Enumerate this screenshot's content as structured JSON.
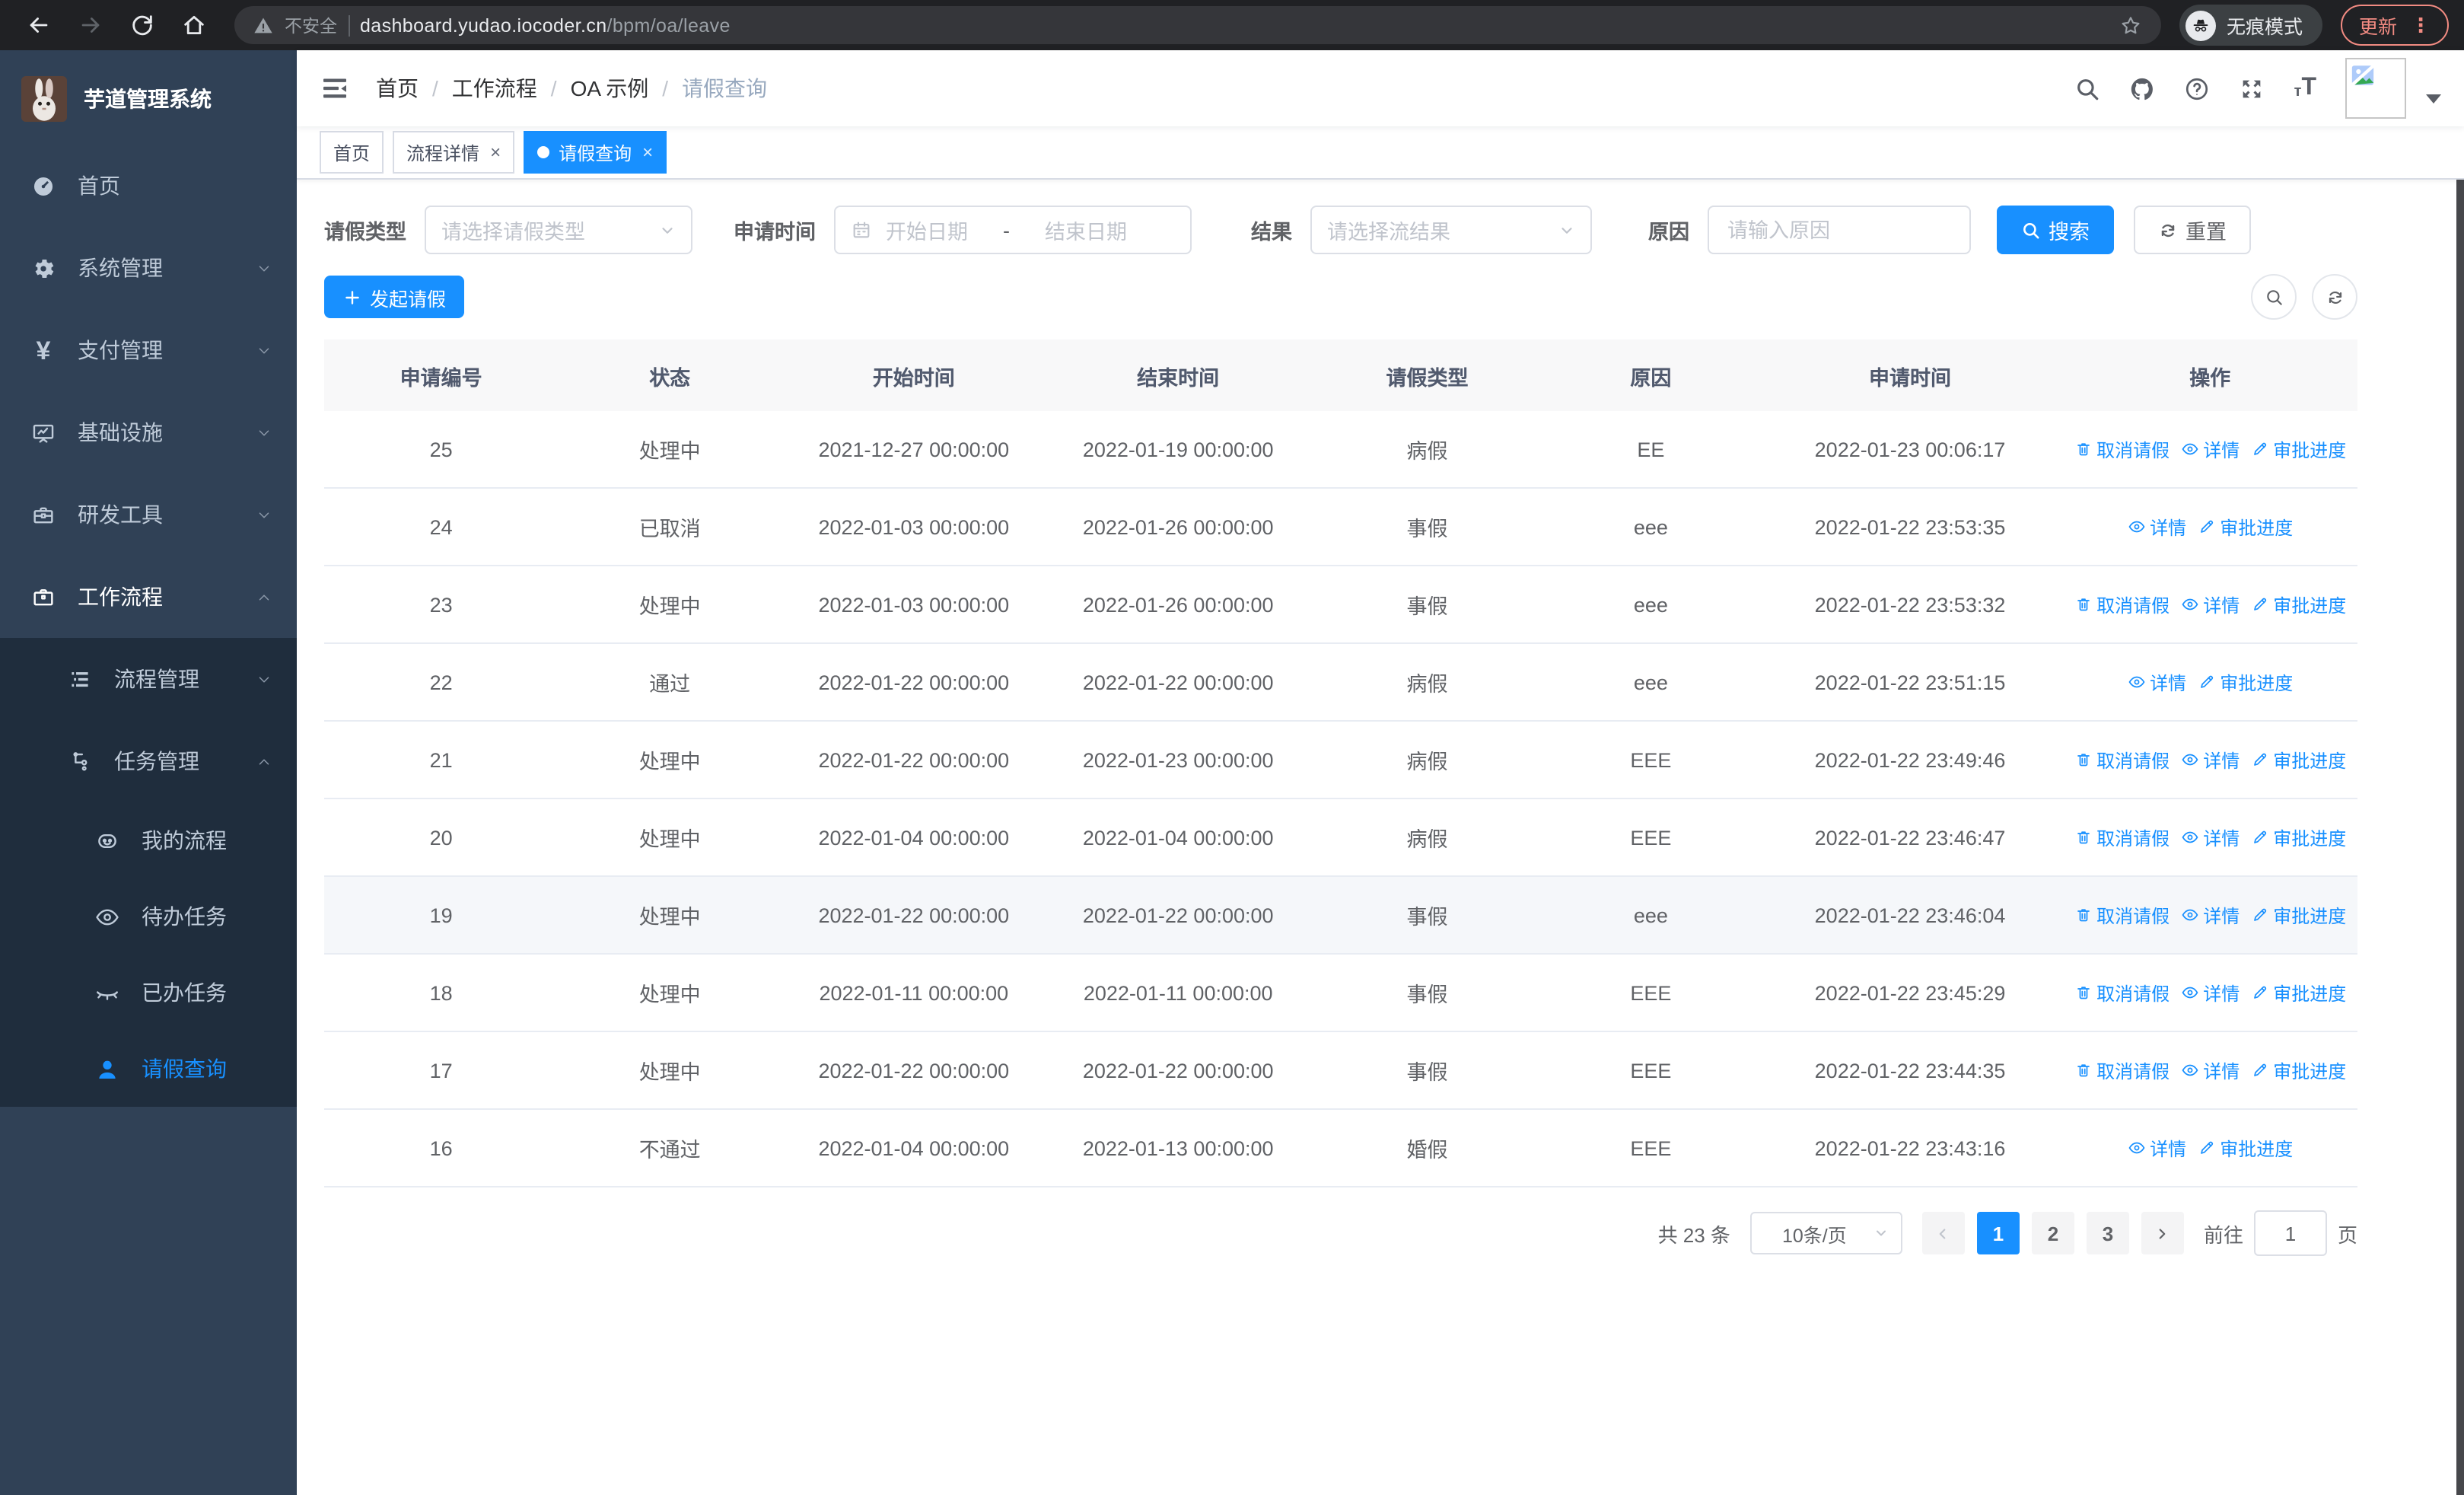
{
  "browser": {
    "security_label": "不安全",
    "url_host": "dashboard.yudao.iocoder.cn",
    "url_path": "/bpm/oa/leave",
    "incognito_label": "无痕模式",
    "update_label": "更新"
  },
  "colors": {
    "accent": "#1890ff",
    "sidebar_bg": "#304156",
    "submenu_bg": "#1f2d3d"
  },
  "sidebar": {
    "logo_title": "芋道管理系统",
    "items": [
      {
        "label": "首页",
        "icon": "dashboard"
      },
      {
        "label": "系统管理",
        "icon": "gear",
        "chevron": "down"
      },
      {
        "label": "支付管理",
        "icon": "yen",
        "chevron": "down"
      },
      {
        "label": "基础设施",
        "icon": "monitor",
        "chevron": "down"
      },
      {
        "label": "研发工具",
        "icon": "toolbox",
        "chevron": "down"
      },
      {
        "label": "工作流程",
        "icon": "briefcase",
        "chevron": "up",
        "parent_active": true
      }
    ],
    "submenu": [
      {
        "label": "流程管理",
        "icon": "flow-list",
        "chevron": "down",
        "level": 1
      },
      {
        "label": "任务管理",
        "icon": "tree",
        "chevron": "up",
        "level": 1
      },
      {
        "label": "我的流程",
        "icon": "robot",
        "level": 2
      },
      {
        "label": "待办任务",
        "icon": "eye-open",
        "level": 2
      },
      {
        "label": "已办任务",
        "icon": "eye-closed",
        "level": 2
      },
      {
        "label": "请假查询",
        "icon": "user",
        "level": 2,
        "active": true
      }
    ]
  },
  "navbar": {
    "breadcrumb": [
      "首页",
      "工作流程",
      "OA 示例",
      "请假查询"
    ]
  },
  "tags": [
    {
      "label": "首页",
      "closable": false,
      "active": false
    },
    {
      "label": "流程详情",
      "closable": true,
      "active": false
    },
    {
      "label": "请假查询",
      "closable": true,
      "active": true
    }
  ],
  "filters": {
    "leave_type_label": "请假类型",
    "leave_type_placeholder": "请选择请假类型",
    "apply_time_label": "申请时间",
    "start_placeholder": "开始日期",
    "range_separator": "-",
    "end_placeholder": "结束日期",
    "result_label": "结果",
    "result_placeholder": "请选择流结果",
    "reason_label": "原因",
    "reason_placeholder": "请输入原因",
    "search_label": "搜索",
    "reset_label": "重置"
  },
  "toolbar": {
    "create_label": "发起请假"
  },
  "table": {
    "headers": [
      "申请编号",
      "状态",
      "开始时间",
      "结束时间",
      "请假类型",
      "原因",
      "申请时间",
      "操作"
    ],
    "action_labels": {
      "cancel": "取消请假",
      "detail": "详情",
      "progress": "审批进度"
    },
    "rows": [
      {
        "id": "25",
        "status": "处理中",
        "start": "2021-12-27 00:00:00",
        "end": "2022-01-19 00:00:00",
        "type": "病假",
        "reason": "EE",
        "apply": "2022-01-23 00:06:17",
        "actions": [
          "cancel",
          "detail",
          "progress"
        ],
        "highlight": false
      },
      {
        "id": "24",
        "status": "已取消",
        "start": "2022-01-03 00:00:00",
        "end": "2022-01-26 00:00:00",
        "type": "事假",
        "reason": "eee",
        "apply": "2022-01-22 23:53:35",
        "actions": [
          "detail",
          "progress"
        ],
        "highlight": false
      },
      {
        "id": "23",
        "status": "处理中",
        "start": "2022-01-03 00:00:00",
        "end": "2022-01-26 00:00:00",
        "type": "事假",
        "reason": "eee",
        "apply": "2022-01-22 23:53:32",
        "actions": [
          "cancel",
          "detail",
          "progress"
        ],
        "highlight": false
      },
      {
        "id": "22",
        "status": "通过",
        "start": "2022-01-22 00:00:00",
        "end": "2022-01-22 00:00:00",
        "type": "病假",
        "reason": "eee",
        "apply": "2022-01-22 23:51:15",
        "actions": [
          "detail",
          "progress"
        ],
        "highlight": false
      },
      {
        "id": "21",
        "status": "处理中",
        "start": "2022-01-22 00:00:00",
        "end": "2022-01-23 00:00:00",
        "type": "病假",
        "reason": "EEE",
        "apply": "2022-01-22 23:49:46",
        "actions": [
          "cancel",
          "detail",
          "progress"
        ],
        "highlight": false
      },
      {
        "id": "20",
        "status": "处理中",
        "start": "2022-01-04 00:00:00",
        "end": "2022-01-04 00:00:00",
        "type": "病假",
        "reason": "EEE",
        "apply": "2022-01-22 23:46:47",
        "actions": [
          "cancel",
          "detail",
          "progress"
        ],
        "highlight": false
      },
      {
        "id": "19",
        "status": "处理中",
        "start": "2022-01-22 00:00:00",
        "end": "2022-01-22 00:00:00",
        "type": "事假",
        "reason": "eee",
        "apply": "2022-01-22 23:46:04",
        "actions": [
          "cancel",
          "detail",
          "progress"
        ],
        "highlight": true
      },
      {
        "id": "18",
        "status": "处理中",
        "start": "2022-01-11 00:00:00",
        "end": "2022-01-11 00:00:00",
        "type": "事假",
        "reason": "EEE",
        "apply": "2022-01-22 23:45:29",
        "actions": [
          "cancel",
          "detail",
          "progress"
        ],
        "highlight": false
      },
      {
        "id": "17",
        "status": "处理中",
        "start": "2022-01-22 00:00:00",
        "end": "2022-01-22 00:00:00",
        "type": "事假",
        "reason": "EEE",
        "apply": "2022-01-22 23:44:35",
        "actions": [
          "cancel",
          "detail",
          "progress"
        ],
        "highlight": false
      },
      {
        "id": "16",
        "status": "不通过",
        "start": "2022-01-04 00:00:00",
        "end": "2022-01-13 00:00:00",
        "type": "婚假",
        "reason": "EEE",
        "apply": "2022-01-22 23:43:16",
        "actions": [
          "detail",
          "progress"
        ],
        "highlight": false
      }
    ]
  },
  "pagination": {
    "total": "共 23 条",
    "page_size": "10条/页",
    "pages": [
      "1",
      "2",
      "3"
    ],
    "active_page": "1",
    "goto_label": "前往",
    "goto_value": "1",
    "unit_label": "页"
  }
}
